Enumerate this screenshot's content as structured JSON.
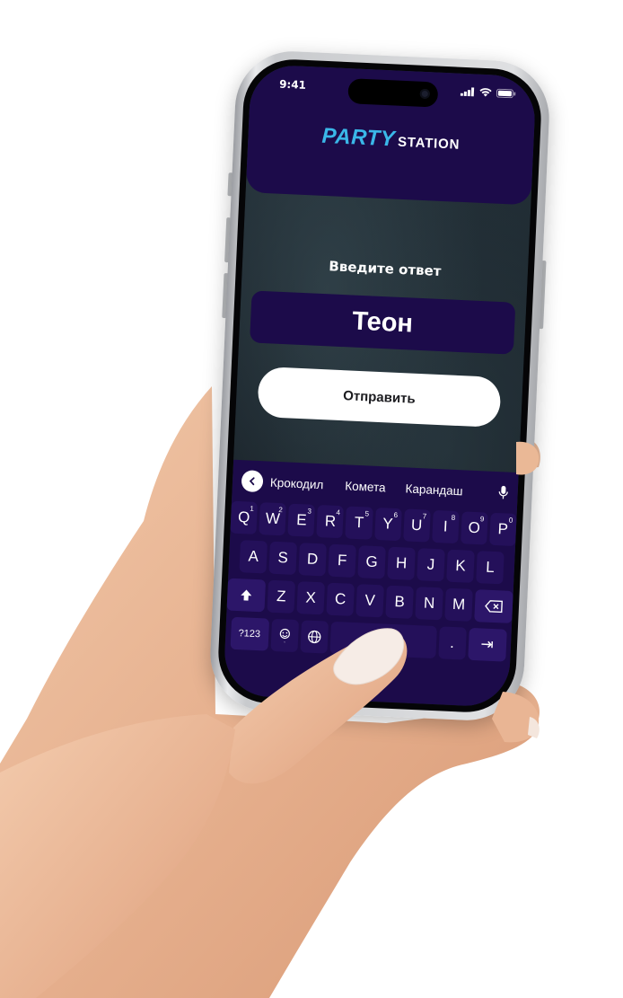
{
  "status_bar": {
    "time": "9:41"
  },
  "header": {
    "logo_party": "PARTY",
    "logo_station": "STATION"
  },
  "form": {
    "prompt": "Введите ответ",
    "answer_value": "Теон",
    "submit_label": "Отправить"
  },
  "keyboard": {
    "suggestions": [
      "Крокодил",
      "Комета",
      "Карандаш"
    ],
    "row1": [
      {
        "key": "Q",
        "hint": "1"
      },
      {
        "key": "W",
        "hint": "2"
      },
      {
        "key": "E",
        "hint": "3"
      },
      {
        "key": "R",
        "hint": "4"
      },
      {
        "key": "T",
        "hint": "5"
      },
      {
        "key": "Y",
        "hint": "6"
      },
      {
        "key": "U",
        "hint": "7"
      },
      {
        "key": "I",
        "hint": "8"
      },
      {
        "key": "O",
        "hint": "9"
      },
      {
        "key": "P",
        "hint": "0"
      }
    ],
    "row2": [
      "A",
      "S",
      "D",
      "F",
      "G",
      "H",
      "J",
      "K",
      "L"
    ],
    "row3": [
      "Z",
      "X",
      "C",
      "V",
      "B",
      "N",
      "M"
    ],
    "symbols_key": "?123",
    "period_key": ".",
    "enter_key": "⇥"
  },
  "colors": {
    "header_bg": "#1c0b4a",
    "logo_accent": "#3ab7e8",
    "button_bg": "#ffffff"
  }
}
